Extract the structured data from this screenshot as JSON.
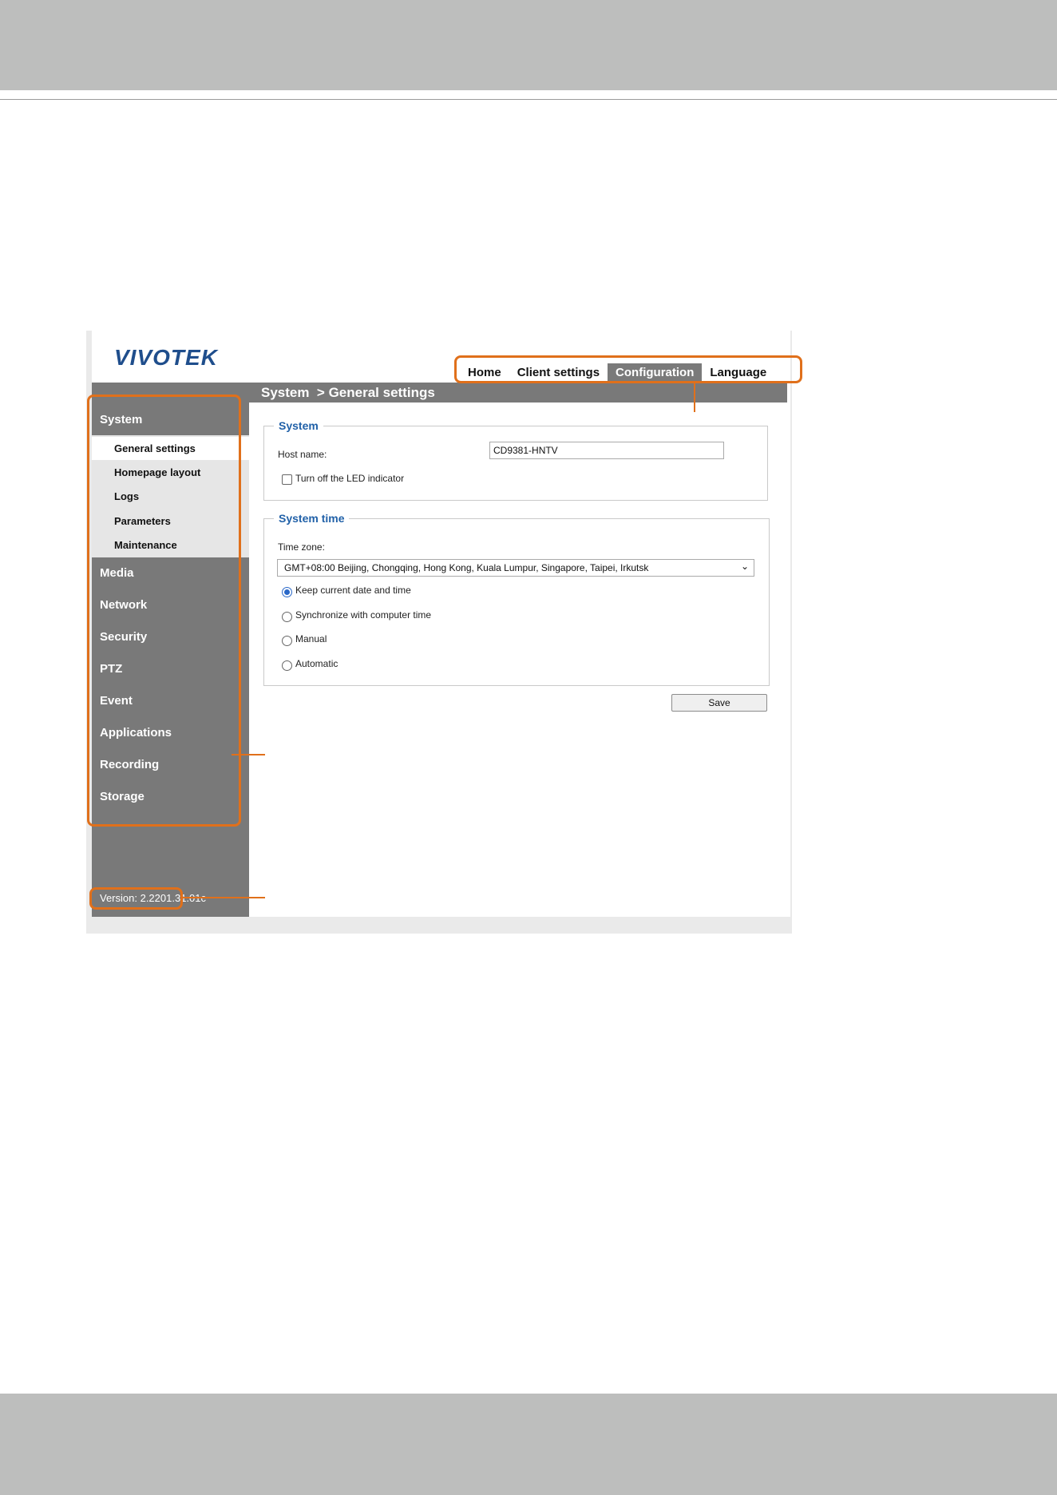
{
  "app": {
    "logo_text": "VIVOTEK",
    "breadcrumb": "System  > General settings",
    "version": "Version: 2.2201.31.01c"
  },
  "topnav": [
    {
      "label": "Home",
      "active": false
    },
    {
      "label": "Client settings",
      "active": false
    },
    {
      "label": "Configuration",
      "active": true
    },
    {
      "label": "Language",
      "active": false
    }
  ],
  "sidebar": {
    "system_label": "System",
    "submenu": [
      {
        "label": "General settings",
        "active": true
      },
      {
        "label": "Homepage layout",
        "active": false
      },
      {
        "label": "Logs",
        "active": false
      },
      {
        "label": "Parameters",
        "active": false
      },
      {
        "label": "Maintenance",
        "active": false
      }
    ],
    "items": [
      {
        "label": "Media"
      },
      {
        "label": "Network"
      },
      {
        "label": "Security"
      },
      {
        "label": "PTZ"
      },
      {
        "label": "Event"
      },
      {
        "label": "Applications"
      },
      {
        "label": "Recording"
      },
      {
        "label": "Storage"
      }
    ]
  },
  "system_section": {
    "legend": "System",
    "host_label": "Host name:",
    "host_value": "CD9381-HNTV",
    "led_label": "Turn off the LED indicator"
  },
  "time_section": {
    "legend": "System time",
    "tz_label": "Time zone:",
    "tz_value": "GMT+08:00 Beijing, Chongqing, Hong Kong, Kuala Lumpur, Singapore, Taipei, Irkutsk",
    "options": [
      {
        "label": "Keep current date and time",
        "checked": true
      },
      {
        "label": "Synchronize with computer time",
        "checked": false
      },
      {
        "label": "Manual",
        "checked": false
      },
      {
        "label": "Automatic",
        "checked": false
      }
    ]
  },
  "save_label": "Save",
  "colors": {
    "accent": "#2161a8",
    "callout": "#e0701b",
    "sidebar": "#797979"
  }
}
